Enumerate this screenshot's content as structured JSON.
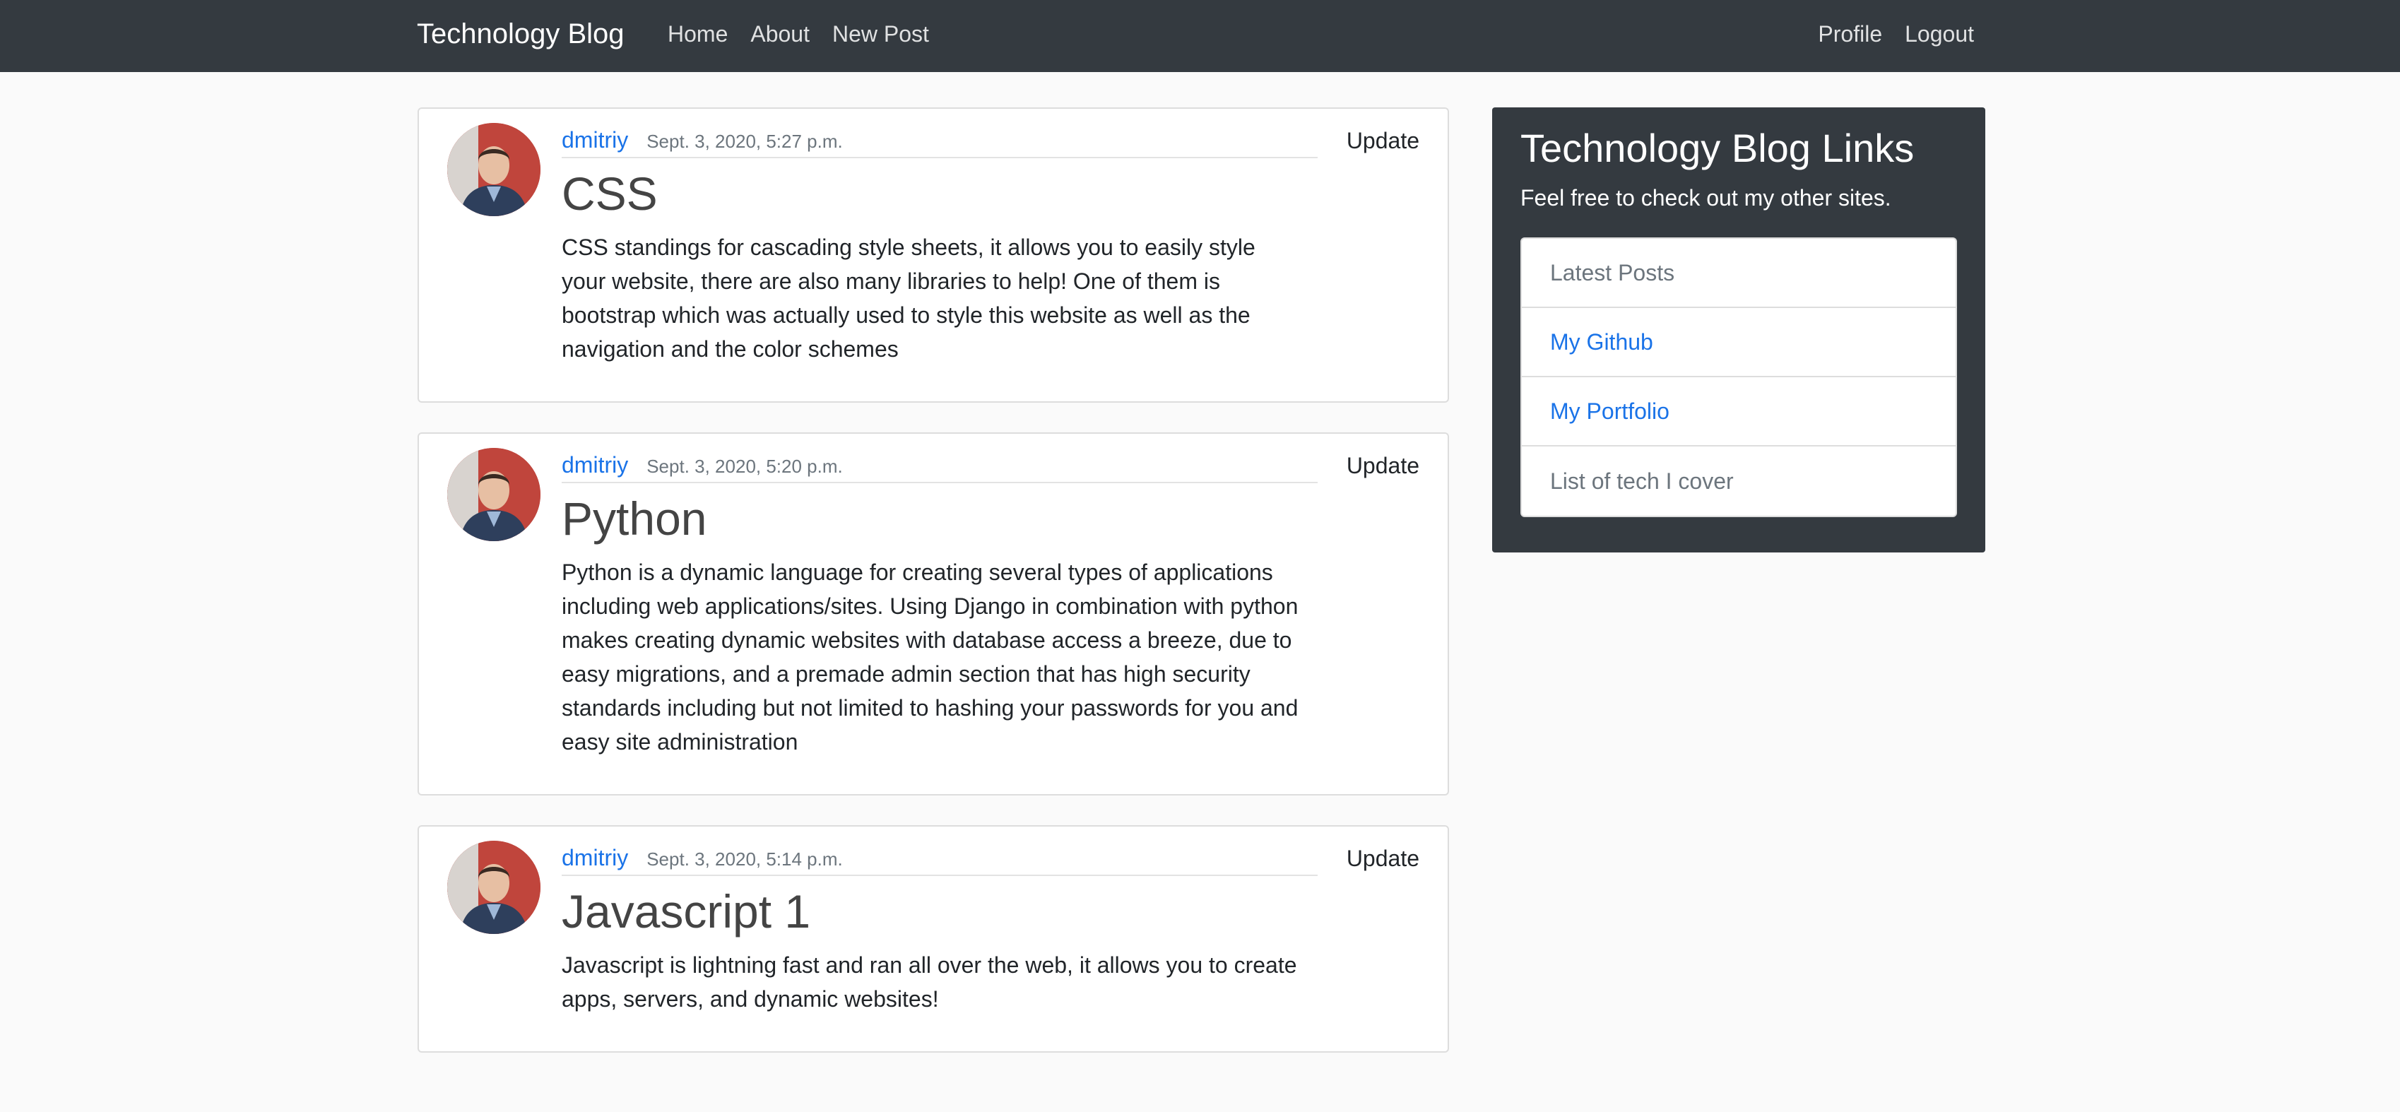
{
  "navbar": {
    "brand": "Technology Blog",
    "links": [
      "Home",
      "About",
      "New Post"
    ],
    "right_links": [
      "Profile",
      "Logout"
    ]
  },
  "posts": [
    {
      "author": "dmitriy",
      "date": "Sept. 3, 2020, 5:27 p.m.",
      "update_label": "Update",
      "title": "CSS",
      "content": "CSS standings for cascading style sheets, it allows you to easily style your website, there are also many libraries to help! One of them is bootstrap which was actually used to style this website as well as the navigation and the color schemes"
    },
    {
      "author": "dmitriy",
      "date": "Sept. 3, 2020, 5:20 p.m.",
      "update_label": "Update",
      "title": "Python",
      "content": "Python is a dynamic language for creating several types of applications including web applications/sites. Using Django in combination with python makes creating dynamic websites with database access a breeze, due to easy migrations, and a premade admin section that has high security standards including but not limited to hashing your passwords for you and easy site administration"
    },
    {
      "author": "dmitriy",
      "date": "Sept. 3, 2020, 5:14 p.m.",
      "update_label": "Update",
      "title": "Javascript 1",
      "content": "Javascript is lightning fast and ran all over the web, it allows you to create apps, servers, and dynamic websites!"
    }
  ],
  "sidebar": {
    "title": "Technology Blog Links",
    "subtitle": "Feel free to check out my other sites.",
    "items": [
      {
        "label": "Latest Posts",
        "style": "muted"
      },
      {
        "label": "My Github",
        "style": "link"
      },
      {
        "label": "My Portfolio",
        "style": "link"
      },
      {
        "label": "List of tech I cover",
        "style": "muted"
      }
    ]
  },
  "colors": {
    "navbar_bg": "#343a40",
    "link": "#1a73e8",
    "page_bg": "#fafafa"
  }
}
